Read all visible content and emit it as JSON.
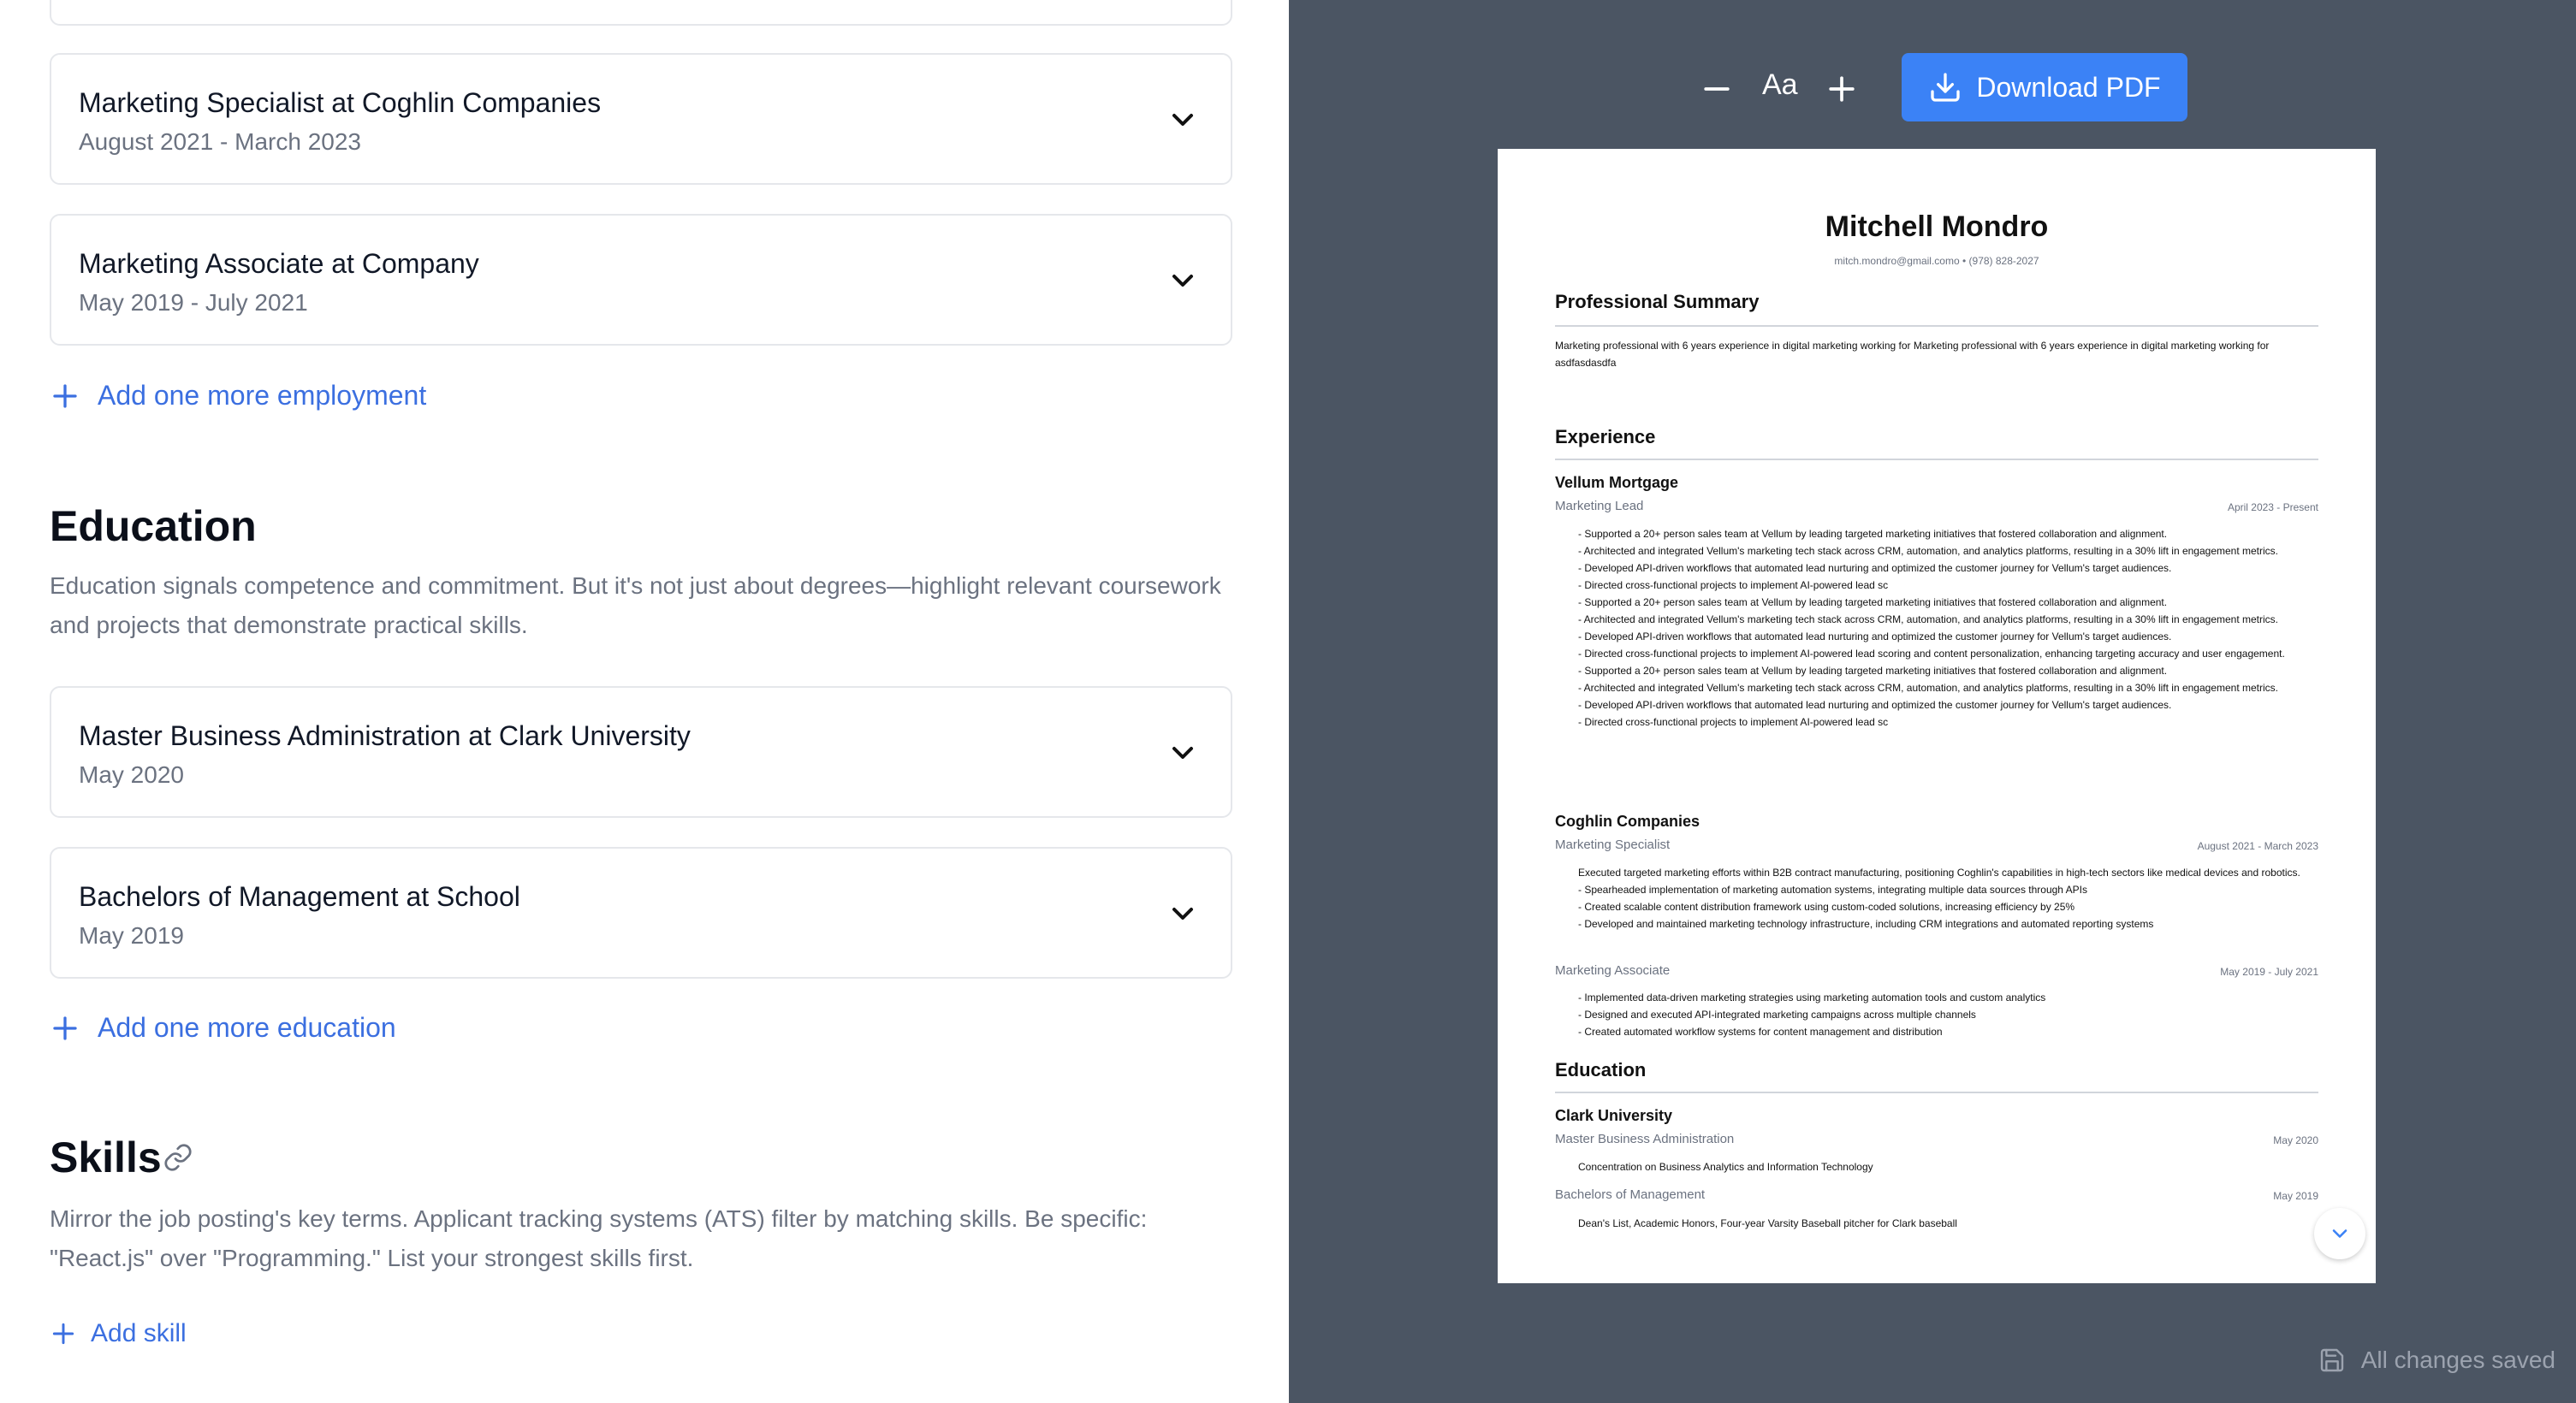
{
  "employment": {
    "items": [
      {
        "title": "Marketing Specialist at Coghlin Companies",
        "dates": "August 2021 - March 2023"
      },
      {
        "title": "Marketing Associate at Company",
        "dates": "May 2019 - July 2021"
      }
    ],
    "add_label": "Add one more employment"
  },
  "education": {
    "heading": "Education",
    "description": "Education signals competence and commitment. But it's not just about degrees—highlight relevant coursework and projects that demonstrate practical skills.",
    "items": [
      {
        "title": "Master Business Administration at Clark University",
        "dates": "May 2020"
      },
      {
        "title": "Bachelors of Management at School",
        "dates": "May 2019"
      }
    ],
    "add_label": "Add one more education"
  },
  "skills": {
    "heading": "Skills",
    "description": "Mirror the job posting's key terms. Applicant tracking systems (ATS) filter by matching skills. Be specific: \"React.js\" over \"Programming.\" List your strongest skills first.",
    "add_label": "Add skill"
  },
  "toolbar": {
    "font_label": "Aa",
    "download_label": "Download PDF"
  },
  "resume": {
    "name": "Mitchell Mondro",
    "contact": "mitch.mondro@gmail.como   •   (978) 828-2027",
    "summary_heading": "Professional Summary",
    "summary": "Marketing professional with 6 years experience in digital marketing working for Marketing professional with 6 years experience in digital marketing working for asdfasdasdfa",
    "experience_heading": "Experience",
    "vellum": {
      "company": "Vellum Mortgage",
      "role": "Marketing Lead",
      "dates": "April 2023 - Present",
      "bullets": [
        "- Supported a 20+ person sales team at Vellum by leading targeted marketing initiatives that fostered collaboration and alignment.",
        "- Architected and integrated Vellum's marketing tech stack across CRM, automation, and analytics platforms, resulting in a 30% lift in engagement metrics.",
        "- Developed API-driven workflows that automated lead nurturing and optimized the customer journey for Vellum's target audiences.",
        "- Directed cross-functional projects to implement AI-powered lead sc",
        "- Supported a 20+ person sales team at Vellum by leading targeted marketing initiatives that fostered collaboration and alignment.",
        "- Architected and integrated Vellum's marketing tech stack across CRM, automation, and analytics platforms, resulting in a 30% lift in engagement metrics.",
        "- Developed API-driven workflows that automated lead nurturing and optimized the customer journey for Vellum's target audiences.",
        "- Directed cross-functional projects to implement AI-powered lead scoring and content personalization, enhancing targeting accuracy and user engagement.",
        "- Supported a 20+ person sales team at Vellum by leading targeted marketing initiatives that fostered collaboration and alignment.",
        "- Architected and integrated Vellum's marketing tech stack across CRM, automation, and analytics platforms, resulting in a 30% lift in engagement metrics.",
        "- Developed API-driven workflows that automated lead nurturing and optimized the customer journey for Vellum's target audiences.",
        "- Directed cross-functional projects to implement AI-powered lead sc"
      ]
    },
    "coghlin": {
      "company": "Coghlin Companies",
      "role1": "Marketing Specialist",
      "dates1": "August 2021 - March 2023",
      "bullets1": [
        "Executed targeted marketing efforts within B2B contract manufacturing, positioning Coghlin's capabilities in high-tech sectors like medical devices and robotics.",
        "- Spearheaded implementation of marketing automation systems, integrating multiple data sources through APIs",
        "- Created scalable content distribution framework using custom-coded solutions, increasing efficiency by 25%",
        "- Developed and maintained marketing technology infrastructure, including CRM integrations and automated reporting systems"
      ],
      "role2": "Marketing Associate",
      "dates2": "May 2019 - July 2021",
      "bullets2": [
        "- Implemented data-driven marketing strategies using marketing automation tools and custom analytics",
        "- Designed and executed API-integrated marketing campaigns across multiple channels",
        "- Created automated workflow systems for content management and distribution"
      ]
    },
    "education_heading": "Education",
    "clark": {
      "school": "Clark University",
      "degree": "Master Business Administration",
      "date": "May 2020",
      "detail": "Concentration on Business Analytics and Information Technology"
    },
    "school2": {
      "degree": "Bachelors of Management",
      "date": "May 2019",
      "detail": "Dean's List, Academic Honors, Four-year Varsity Baseball pitcher for Clark baseball"
    }
  },
  "status": {
    "saved_label": "All changes saved"
  }
}
